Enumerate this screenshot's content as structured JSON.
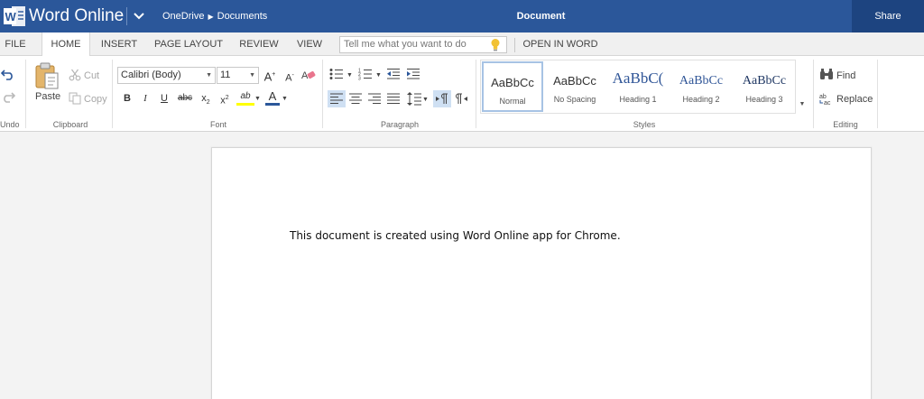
{
  "app": {
    "title": "Word Online",
    "breadcrumb": [
      "OneDrive",
      "Documents"
    ],
    "breadcrumb_sep": "▶",
    "document_title": "Document",
    "share_label": "Share",
    "brand_color": "#2b579a"
  },
  "tabs": {
    "file": "FILE",
    "home": "HOME",
    "insert": "INSERT",
    "page_layout": "PAGE LAYOUT",
    "review": "REVIEW",
    "view": "VIEW",
    "tell_me_placeholder": "Tell me what you want to do",
    "open_in_word": "OPEN IN WORD",
    "active": "HOME"
  },
  "ribbon": {
    "undo": {
      "label": "Undo"
    },
    "clipboard": {
      "label": "Clipboard",
      "paste": "Paste",
      "cut": "Cut",
      "copy": "Copy"
    },
    "font": {
      "label": "Font",
      "family": "Calibri (Body)",
      "size": "11",
      "bold": "B",
      "italic": "I",
      "underline": "U",
      "strike": "abc",
      "subscript": "x",
      "subscript_mark": "2",
      "superscript": "x",
      "superscript_mark": "2",
      "highlight": "ab",
      "font_color": "A",
      "grow": "A",
      "shrink": "A",
      "highlight_color": "#ffff00",
      "font_color_value": "#2b579a"
    },
    "paragraph": {
      "label": "Paragraph"
    },
    "styles": {
      "label": "Styles",
      "items": [
        {
          "preview": "AaBbCc",
          "name": "Normal"
        },
        {
          "preview": "AaBbCc",
          "name": "No Spacing"
        },
        {
          "preview": "AaBbC(",
          "name": "Heading 1"
        },
        {
          "preview": "AaBbCc",
          "name": "Heading 2"
        },
        {
          "preview": "AaBbCc",
          "name": "Heading 3"
        }
      ],
      "selected": "Normal"
    },
    "editing": {
      "label": "Editing",
      "find": "Find",
      "replace": "Replace"
    }
  },
  "document": {
    "body": "This document is created using Word Online app for Chrome."
  }
}
